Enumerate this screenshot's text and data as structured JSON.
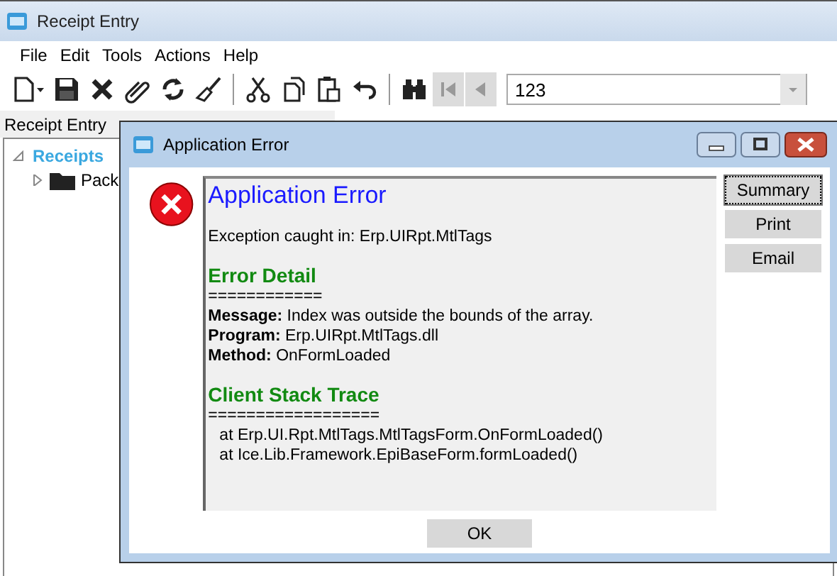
{
  "window": {
    "title": "Receipt Entry"
  },
  "menu": [
    "File",
    "Edit",
    "Tools",
    "Actions",
    "Help"
  ],
  "toolbar": {
    "record_field": {
      "value": "123"
    }
  },
  "panel_title": "Receipt Entry",
  "tree": [
    {
      "label": "Receipts",
      "expanded": true,
      "selected": true,
      "children": [
        {
          "label": "Pack",
          "expanded": false,
          "selected": false
        }
      ]
    }
  ],
  "dialog": {
    "title": "Application Error",
    "heading": "Application Error",
    "exception": "Exception caught in: Erp.UIRpt.MtlTags",
    "sections": [
      {
        "kind": "detail",
        "heading": "Error Detail",
        "rule": "============",
        "lines": [
          "**Message:** Index was outside the bounds of the array.",
          "**Program:** Erp.UIRpt.MtlTags.dll",
          "**Method:** OnFormLoaded"
        ]
      },
      {
        "kind": "trace",
        "heading": "Client Stack Trace",
        "rule": "==================",
        "lines": [
          "at Erp.UI.Rpt.MtlTags.MtlTagsForm.OnFormLoaded()",
          "at Ice.Lib.Framework.EpiBaseForm.formLoaded()"
        ]
      }
    ],
    "side_buttons": [
      {
        "label": "Summary",
        "selected": true
      },
      {
        "label": "Print",
        "selected": false
      },
      {
        "label": "Email",
        "selected": false
      }
    ],
    "ok_button": "OK"
  }
}
